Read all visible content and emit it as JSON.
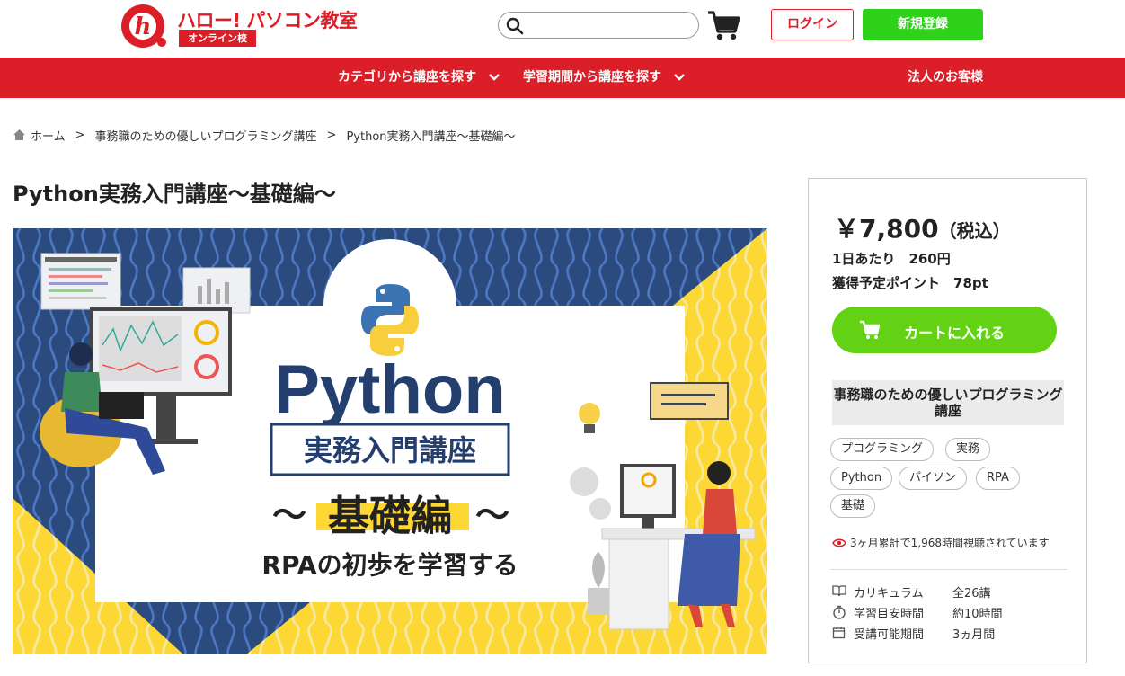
{
  "brand": {
    "name": "ハロー! パソコン教室",
    "sub": "オンライン校",
    "mark_letter": "h",
    "color": "#dc1e28"
  },
  "header": {
    "search_placeholder": "",
    "login_label": "ログイン",
    "register_label": "新規登録"
  },
  "nav": {
    "category_label": "カテゴリから講座を探す",
    "period_label": "学習期間から講座を探す",
    "corporate_label": "法人のお客様"
  },
  "breadcrumb": {
    "home": "ホーム",
    "separator": ">",
    "category": "事務職のための優しいプログラミング講座",
    "current": "Python実務入門講座～基礎編～"
  },
  "course": {
    "title": "Python実務入門講座～基礎編～",
    "hero": {
      "title": "Python",
      "subtitle": "実務入門講座",
      "edition": "基礎編",
      "tilde": "～",
      "tagline": "RPAの初歩を学習する"
    }
  },
  "sidebar": {
    "price": "￥7,800",
    "tax_note": "（税込）",
    "per_day": "1日あたり　260円",
    "points": "獲得予定ポイント　78pt",
    "cart_button": "カートに入れる",
    "series": "事務職のための優しいプログラミング講座",
    "tags": [
      "プログラミング",
      "実務",
      "Python",
      "パイソン",
      "RPA",
      "基礎"
    ],
    "views": "3ヶ月累計で1,968時間視聴されています",
    "info": [
      {
        "label": "カリキュラム",
        "value": "全26講",
        "icon": "book-icon"
      },
      {
        "label": "学習目安時間",
        "value": "約10時間",
        "icon": "stopwatch-icon"
      },
      {
        "label": "受講可能期間",
        "value": "3ヵ月間",
        "icon": "calendar-icon"
      }
    ]
  },
  "colors": {
    "primary_red": "#dc1e28",
    "register_green": "#2fd21a",
    "cart_green": "#64d214",
    "hero_navy": "#2b4a7e",
    "hero_yellow": "#fdd835"
  }
}
